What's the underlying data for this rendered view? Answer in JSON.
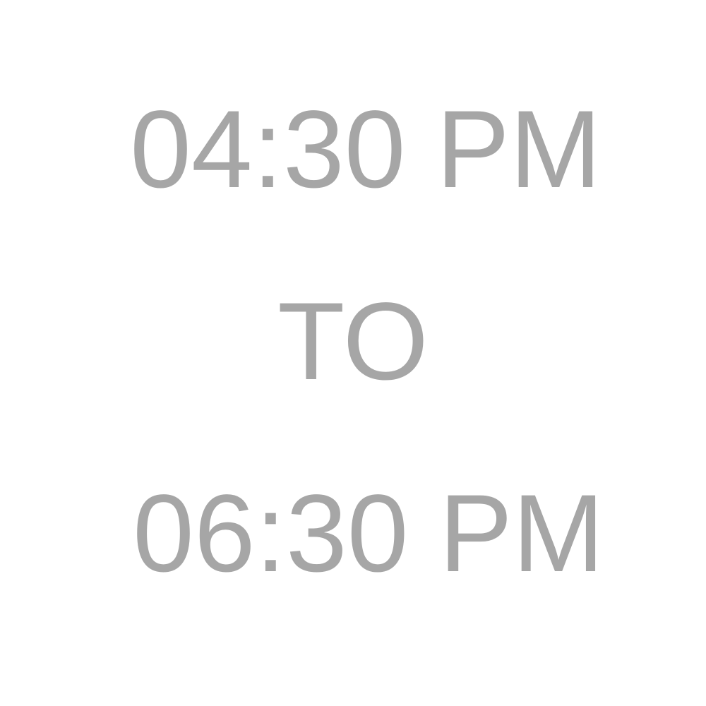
{
  "colors": {
    "background": "#ffffff",
    "text": "#a6a6a6"
  },
  "time_range": {
    "start": "04:30 PM",
    "separator": "TO",
    "end": "06:30 PM"
  }
}
